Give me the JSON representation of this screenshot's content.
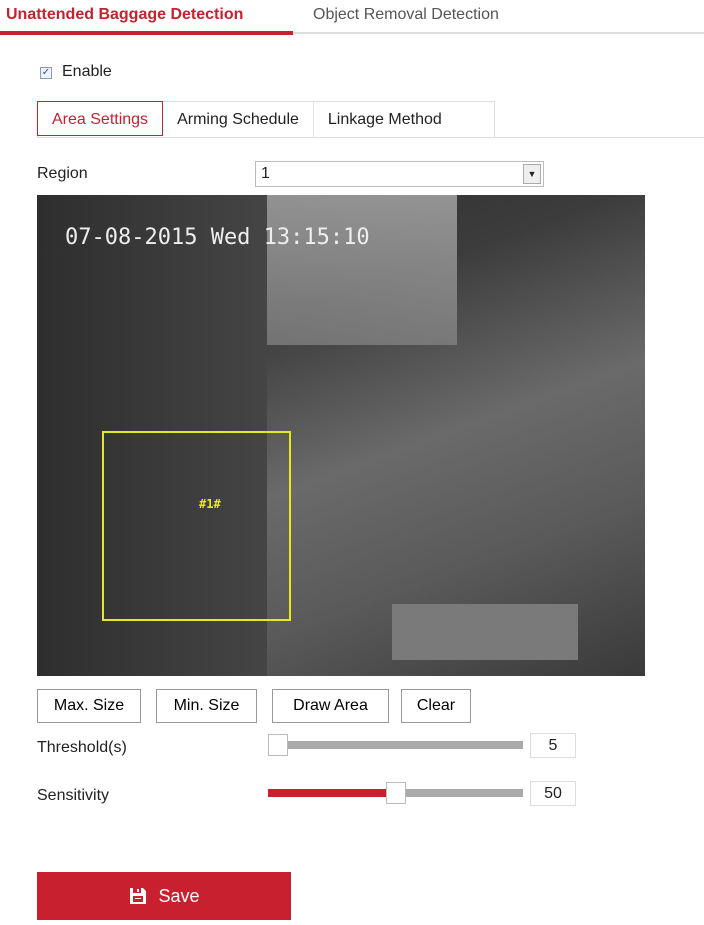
{
  "tabs": [
    {
      "label": "Unattended Baggage Detection",
      "active": true
    },
    {
      "label": "Object Removal Detection",
      "active": false
    }
  ],
  "enable": {
    "label": "Enable",
    "checked": true
  },
  "subtabs": [
    {
      "label": "Area Settings",
      "active": true
    },
    {
      "label": "Arming Schedule"
    },
    {
      "label": "Linkage Method"
    }
  ],
  "region": {
    "label": "Region",
    "value": "1"
  },
  "video": {
    "timestamp": "07-08-2015 Wed 13:15:10",
    "area_label": "#1#"
  },
  "buttons": {
    "max": "Max. Size",
    "min": "Min. Size",
    "draw": "Draw Area",
    "clear": "Clear"
  },
  "threshold": {
    "label": "Threshold(s)",
    "value": "5",
    "fraction": 0.0
  },
  "sensitivity": {
    "label": "Sensitivity",
    "value": "50",
    "fraction": 0.5
  },
  "save": {
    "label": "Save",
    "icon": "floppy-disk-icon"
  },
  "colors": {
    "accent": "#c8202f",
    "area": "#e8e820"
  }
}
